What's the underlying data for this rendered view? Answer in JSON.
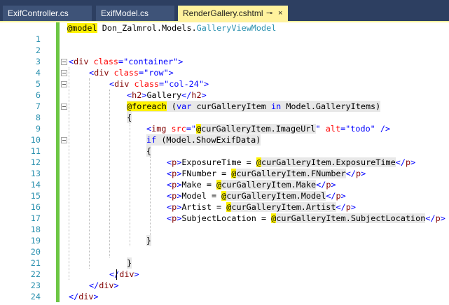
{
  "tabs": [
    {
      "label": "ExifController.cs",
      "active": false
    },
    {
      "label": "ExifModel.cs",
      "active": false
    },
    {
      "label": "RenderGallery.cshtml",
      "active": true,
      "pin_glyph": "⊸",
      "close_glyph": "×"
    }
  ],
  "editor": {
    "line_numbers": [
      "1",
      "2",
      "3",
      "4",
      "5",
      "6",
      "7",
      "8",
      "9",
      "10",
      "11",
      "12",
      "13",
      "14",
      "15",
      "16",
      "17",
      "18",
      "19",
      "20",
      "21",
      "22",
      "23",
      "24"
    ],
    "code": {
      "l1": {
        "directive": "@model",
        "ns": " Don_Zalmrol.Models.",
        "type": "GalleryViewModel"
      },
      "l4": {
        "open": "<",
        "el": "div",
        "attr": " class",
        "eq": "=",
        "val": "\"container\"",
        "close": ">"
      },
      "l5": {
        "open": "<",
        "el": "div",
        "attr": " class",
        "eq": "=",
        "val": "\"row\"",
        "close": ">"
      },
      "l6": {
        "open": "<",
        "el": "div",
        "attr": " class",
        "eq": "=",
        "val": "\"col-24\"",
        "close": ">"
      },
      "l7": {
        "open": "<",
        "el": "h2",
        "close": ">",
        "text": "Gallery",
        "endopen": "</",
        "endel": "h2",
        "endclose": ">"
      },
      "l8": {
        "directive": "@foreach",
        "p1": " (",
        "kw1": "var",
        "mid": " curGalleryItem ",
        "kw2": "in",
        "rest": " Model.GalleryItems)"
      },
      "l9": {
        "text": "{"
      },
      "l10": {
        "open": "<",
        "el": "img",
        "attr1": " src",
        "eq1": "=",
        "q1": "\"",
        "at": "@",
        "expr": "curGalleryItem.ImageUrl",
        "q2": "\"",
        "attr2": " alt",
        "eq2": "=",
        "val2": "\"todo\"",
        "close": " />"
      },
      "l11": {
        "kw": "if",
        "rest": " (Model.ShowExifData)"
      },
      "l12": {
        "text": "{"
      },
      "l13": {
        "label": "ExposureTime = ",
        "at": "@",
        "expr": "curGalleryItem.ExposureTime"
      },
      "l14": {
        "label": "FNumber = ",
        "at": "@",
        "expr": "curGalleryItem.FNumber"
      },
      "l15": {
        "label": "Make = ",
        "at": "@",
        "expr": "curGalleryItem.Make"
      },
      "l16": {
        "label": "Model = ",
        "at": "@",
        "expr": "curGalleryItem.Model"
      },
      "l17": {
        "label": "Artist = ",
        "at": "@",
        "expr": "curGalleryItem.Artist"
      },
      "l18": {
        "label": "SubjectLocation = ",
        "at": "@",
        "expr": "curGalleryItem.SubjectLocation"
      },
      "l20": {
        "text": "}"
      },
      "l21": {
        "text": "}"
      },
      "l22": {
        "text": "}"
      },
      "l23": {
        "open": "</",
        "el": "div",
        "close": ">"
      },
      "l24": {
        "open": "</",
        "el": "div",
        "close": ">"
      },
      "p_open": "<",
      "p_el": "p",
      "p_close": ">",
      "p_endopen": "</",
      "p_endel": "p",
      "p_endclose": ">"
    }
  }
}
